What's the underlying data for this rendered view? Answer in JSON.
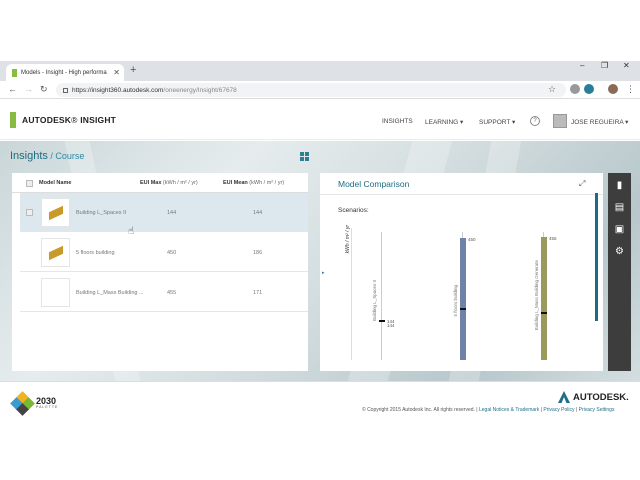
{
  "browser": {
    "tab_title": "Models - Insight - High performa",
    "tab_close": "✕",
    "new_tab": "+",
    "url_host": "https://insight360.autodesk.com",
    "url_path": "/oneenergy/Insight/67678",
    "window_controls": [
      "–",
      "❐",
      "✕"
    ]
  },
  "app": {
    "brand_prefix": "AUTODESK",
    "brand_name": "INSIGHT",
    "nav": {
      "insights": "INSIGHTS",
      "learning": "LEARNING ▾",
      "support": "SUPPORT ▾"
    },
    "help": "?",
    "user_name": "JOSE REGUEIRA ▾"
  },
  "page": {
    "title": "Insights",
    "subtitle": " / Course"
  },
  "models_table": {
    "col_name": "Model Name",
    "col_max": "EUI Max",
    "col_max_unit": " (kWh / m² / yr)",
    "col_mean": "EUI Mean",
    "col_mean_unit": " (kWh / m² / yr)",
    "rows": [
      {
        "name": "Building L_Spaces II",
        "eui_max": "144",
        "eui_mean": "144",
        "selected": true
      },
      {
        "name": "5 floors building",
        "eui_max": "450",
        "eui_mean": "186",
        "selected": false
      },
      {
        "name": "Building L_Mass Building ...",
        "eui_max": "455",
        "eui_mean": "171",
        "selected": false
      }
    ]
  },
  "comparison": {
    "title": "Model Comparison",
    "scenarios_label": "Scenarios:",
    "y_label": "kWh / m² / yr",
    "bars": [
      {
        "name": "Building L_Spaces II",
        "max": 144,
        "mean": 144,
        "color": "#cccccc",
        "max_label": "144",
        "mean_label": "144"
      },
      {
        "name": "5 floors building",
        "max": 450,
        "mean": 186,
        "color": "#6f82a8",
        "max_label": "450"
      },
      {
        "name": "Building L_Mass Building Generate",
        "max": 455,
        "mean": 171,
        "color": "#9a9a5c",
        "max_label": "455"
      }
    ]
  },
  "footer": {
    "palette_name": "2030",
    "palette_sub": "PALETTE",
    "autodesk": "AUTODESK.",
    "copyright": "© Copyright 2015 Autodesk Inc. All rights reserved. | ",
    "legal": "Legal Notices & Trademark",
    "sep1": " | ",
    "privacy": "Privacy Policy",
    "sep2": " | ",
    "privacy_settings": "Privacy Settings"
  },
  "colors": {
    "accent": "#1d6c82",
    "brand_green": "#87bc40",
    "sidebar_dark": "#3d3d3d"
  }
}
